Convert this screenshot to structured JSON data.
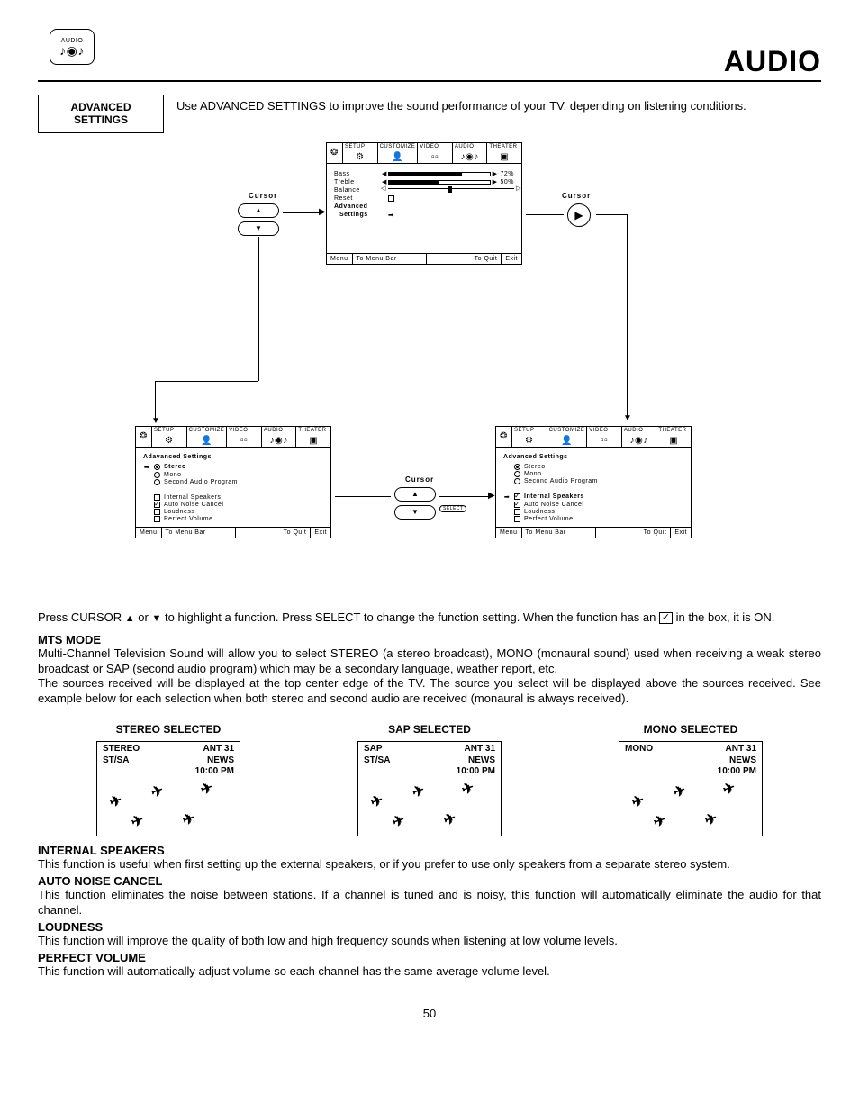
{
  "audio_icon_label": "AUDIO",
  "page_title": "AUDIO",
  "header_box_line1": "ADVANCED",
  "header_box_line2": "SETTINGS",
  "header_desc": "Use ADVANCED SETTINGS to improve the sound performance of your TV, depending on listening conditions.",
  "osd_tabs": [
    "SETUP",
    "CUSTOMIZE",
    "VIDEO",
    "AUDIO",
    "THEATER"
  ],
  "osd_main": {
    "bass_label": "Bass",
    "bass_val": "72%",
    "treble_label": "Treble",
    "treble_val": "50%",
    "balance_label": "Balance",
    "reset_label": "Reset",
    "adv_label1": "Advanced",
    "adv_label2": "Settings"
  },
  "osd_footer": {
    "menu": "Menu",
    "tomenu": "To Menu Bar",
    "toquit": "To Quit",
    "exit": "Exit"
  },
  "cursor_label": "Cursor",
  "select_label": "SELECT",
  "adv_left": {
    "title": "Adavanced Settings",
    "items": [
      {
        "type": "radio",
        "sel": true,
        "label": "Stereo",
        "arrow": true
      },
      {
        "type": "radio",
        "sel": false,
        "label": "Mono"
      },
      {
        "type": "radio",
        "sel": false,
        "label": "Second Audio Program"
      },
      {
        "type": "gap"
      },
      {
        "type": "chk",
        "sel": false,
        "label": "Internal Speakers"
      },
      {
        "type": "chk",
        "sel": true,
        "label": "Auto Noise Cancel"
      },
      {
        "type": "chk",
        "sel": false,
        "label": "Loudness"
      },
      {
        "type": "chk",
        "sel": false,
        "label": "Perfect Volume"
      }
    ]
  },
  "adv_right": {
    "title": "Advanced Settings",
    "items": [
      {
        "type": "radio",
        "sel": true,
        "label": "Stereo"
      },
      {
        "type": "radio",
        "sel": false,
        "label": "Mono"
      },
      {
        "type": "radio",
        "sel": false,
        "label": "Second Audio Program"
      },
      {
        "type": "gap"
      },
      {
        "type": "chk",
        "sel": true,
        "label": "Internal Speakers",
        "arrow": true,
        "bold": true
      },
      {
        "type": "chk",
        "sel": true,
        "label": "Auto Noise Cancel"
      },
      {
        "type": "chk",
        "sel": false,
        "label": "Loudness"
      },
      {
        "type": "chk",
        "sel": false,
        "label": "Perfect Volume"
      }
    ]
  },
  "cursor_instr_pre": "Press CURSOR ",
  "cursor_instr_mid": " or ",
  "cursor_instr_post": " to highlight a function. Press SELECT to change the function setting. When the function has an ",
  "cursor_instr_end": " in the box, it is ON.",
  "mts_head": "MTS MODE",
  "mts_p1": "Multi-Channel Television Sound will allow you to select STEREO (a stereo broadcast), MONO (monaural sound) used when receiving a weak stereo broadcast or SAP (second audio program) which may be a secondary language, weather report, etc.",
  "mts_p2": "The sources received will be displayed at the top center edge of the TV.  The source you select will be displayed above the sources received.  See example below for each selection when both stereo and second audio are received (monaural is always received).",
  "examples": {
    "stereo_title": "STEREO SELECTED",
    "sap_title": "SAP SELECTED",
    "mono_title": "MONO SELECTED",
    "stereo_mode": "STEREO",
    "sap_mode": "SAP",
    "mono_mode": "MONO",
    "stsa": "ST/SA",
    "ant": "ANT   31",
    "news": "NEWS",
    "time": "10:00 PM"
  },
  "int_spk_head": "INTERNAL SPEAKERS",
  "int_spk_txt": "This function is useful when first setting up the external speakers, or if you prefer to use only speakers from a separate stereo system.",
  "anc_head": "AUTO NOISE CANCEL",
  "anc_txt": "This function eliminates the noise between stations. If a channel is tuned and is noisy, this function will automatically eliminate the audio for that channel.",
  "loud_head": "LOUDNESS",
  "loud_txt": "This function will improve the quality of both low and high frequency sounds when listening at low volume levels.",
  "pv_head": "PERFECT VOLUME",
  "pv_txt": "This function will automatically adjust volume so each channel has the same average volume level.",
  "page_num": "50"
}
